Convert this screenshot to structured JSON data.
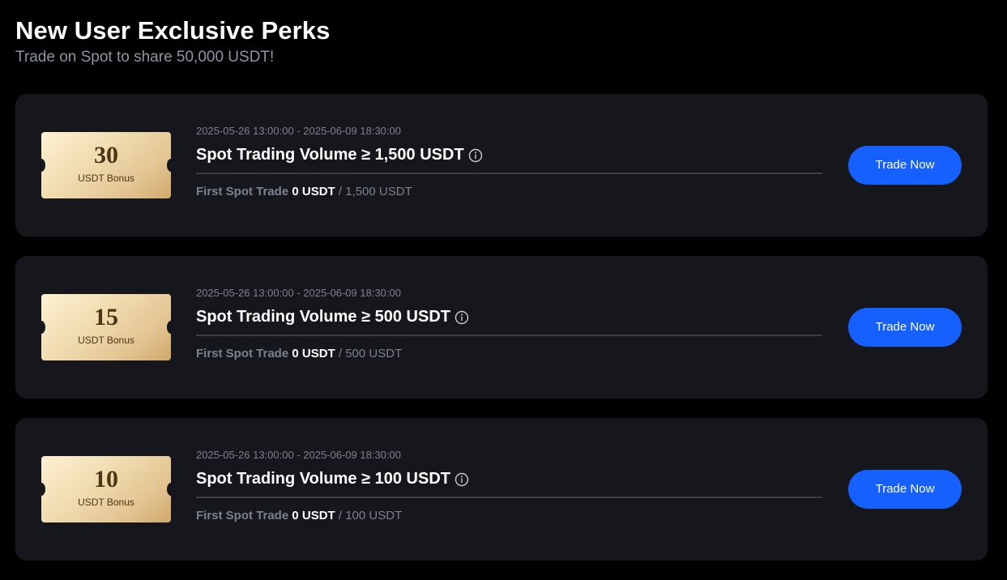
{
  "header": {
    "title": "New User Exclusive Perks",
    "subtitle": "Trade on Spot to share 50,000 USDT!"
  },
  "colors": {
    "background": "#000000",
    "card": "#16171c",
    "accent_button": "#1660ff",
    "ticket_gold": "#e2c491",
    "muted_text": "#7c8190"
  },
  "tasks": [
    {
      "bonus_amount": "30",
      "bonus_label": "USDT Bonus",
      "date_range": "2025-05-26 13:00:00 - 2025-06-09 18:30:00",
      "title": "Spot Trading Volume ≥ 1,500 USDT",
      "info_icon": "info-circle-icon",
      "progress_label": "First Spot Trade",
      "progress_current": "0 USDT",
      "progress_target": "/ 1,500 USDT",
      "progress_fraction": 0,
      "button_label": "Trade Now"
    },
    {
      "bonus_amount": "15",
      "bonus_label": "USDT Bonus",
      "date_range": "2025-05-26 13:00:00 - 2025-06-09 18:30:00",
      "title": "Spot Trading Volume ≥ 500 USDT",
      "info_icon": "info-circle-icon",
      "progress_label": "First Spot Trade",
      "progress_current": "0 USDT",
      "progress_target": "/ 500 USDT",
      "progress_fraction": 0,
      "button_label": "Trade Now"
    },
    {
      "bonus_amount": "10",
      "bonus_label": "USDT Bonus",
      "date_range": "2025-05-26 13:00:00 - 2025-06-09 18:30:00",
      "title": "Spot Trading Volume ≥ 100 USDT",
      "info_icon": "info-circle-icon",
      "progress_label": "First Spot Trade",
      "progress_current": "0 USDT",
      "progress_target": "/ 100 USDT",
      "progress_fraction": 0,
      "button_label": "Trade Now"
    }
  ]
}
